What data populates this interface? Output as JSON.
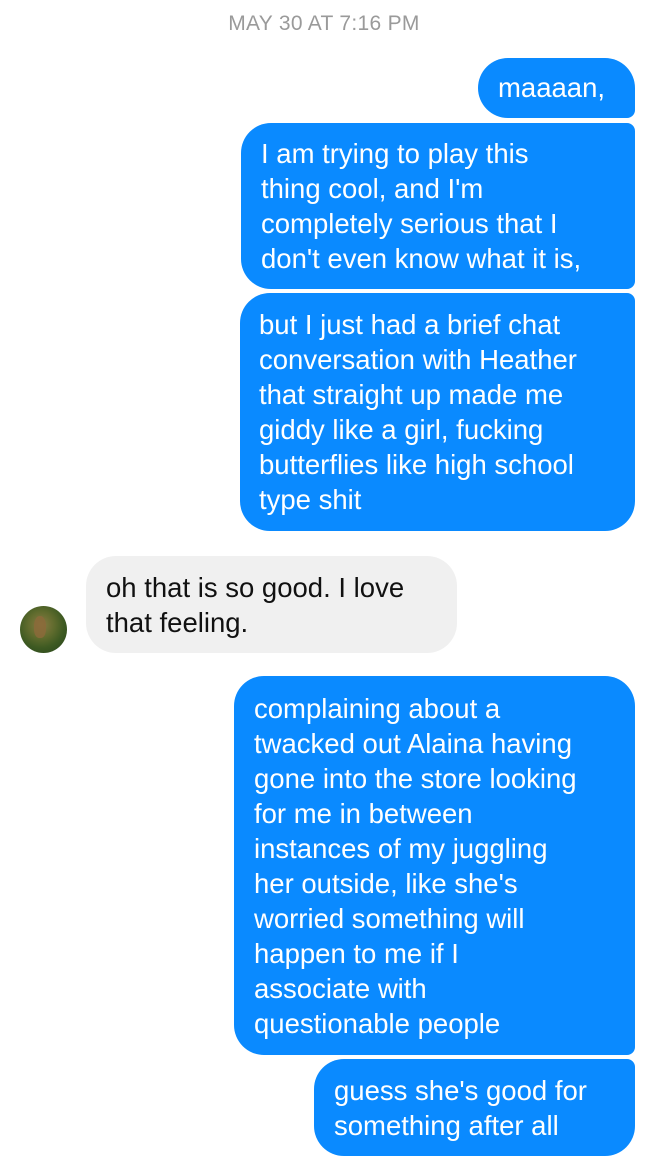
{
  "conversation": {
    "timestamp": "MAY 30 AT 7:16 PM",
    "messages": [
      {
        "sender": "me",
        "text": "maaaan,"
      },
      {
        "sender": "me",
        "text": "I am trying to play this\nthing cool, and I'm\ncompletely serious that I\ndon't even know what it is,"
      },
      {
        "sender": "me",
        "text": "but I just had a brief chat\nconversation with Heather\nthat straight up made me\ngiddy like a girl, fucking\nbutterflies like high school\ntype shit"
      },
      {
        "sender": "other",
        "text": "oh that is so good. I love\nthat feeling."
      },
      {
        "sender": "me",
        "text": "complaining about a\ntwacked out Alaina having\ngone into the store looking\nfor me in between\ninstances of my juggling\nher outside, like she's\nworried something will\nhappen to me if I\nassociate with\nquestionable people"
      },
      {
        "sender": "me",
        "text": "guess she's good for\nsomething after all"
      }
    ]
  },
  "colors": {
    "outgoing_bubble": "#0a8aff",
    "incoming_bubble": "#f0f0f0",
    "timestamp_text": "#9a9a9a"
  },
  "icons": {
    "contact_avatar": "avatar"
  }
}
